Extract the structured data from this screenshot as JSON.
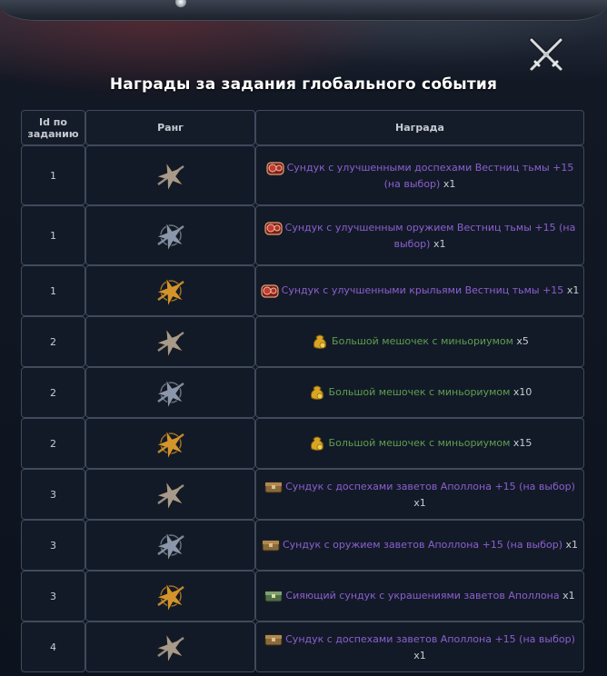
{
  "title": "Награды за задания глобального события",
  "columns": {
    "id": "Id по заданию",
    "rank": "Ранг",
    "reward": "Награда"
  },
  "rows": [
    {
      "id": "1",
      "rank_icon": "rank-bronze-star-icon",
      "item_icon": "red-chest-icon",
      "item": "Сундук с улучшенными доспехами Вестниц тьмы +15 (на выбор)",
      "qty": "x1",
      "color": "purple"
    },
    {
      "id": "1",
      "rank_icon": "rank-silver-star-icon",
      "item_icon": "red-chest-icon",
      "item": "Сундук с улучшенным оружием Вестниц тьмы +15 (на выбор)",
      "qty": "x1",
      "color": "purple"
    },
    {
      "id": "1",
      "rank_icon": "rank-gold-star-icon",
      "item_icon": "red-chest-icon",
      "item": "Сундук с улучшенными крыльями Вестниц тьмы +15",
      "qty": "x1",
      "color": "purple"
    },
    {
      "id": "2",
      "rank_icon": "rank-bronze-star-icon",
      "item_icon": "coin-pouch-icon",
      "item": "Большой мешочек с миньориумом",
      "qty": "x5",
      "color": "green"
    },
    {
      "id": "2",
      "rank_icon": "rank-silver-star-icon",
      "item_icon": "coin-pouch-icon",
      "item": "Большой мешочек с миньориумом",
      "qty": "x10",
      "color": "green"
    },
    {
      "id": "2",
      "rank_icon": "rank-gold-star-icon",
      "item_icon": "coin-pouch-icon",
      "item": "Большой мешочек с миньориумом",
      "qty": "x15",
      "color": "green"
    },
    {
      "id": "3",
      "rank_icon": "rank-bronze-star-icon",
      "item_icon": "wooden-chest-icon",
      "item": "Сундук с доспехами заветов Аполлона +15 (на выбор)",
      "qty": "x1",
      "color": "purple"
    },
    {
      "id": "3",
      "rank_icon": "rank-silver-star-icon",
      "item_icon": "wooden-chest-icon",
      "item": "Сундук с оружием заветов Аполлона +15 (на выбор)",
      "qty": "x1",
      "color": "purple"
    },
    {
      "id": "3",
      "rank_icon": "rank-gold-star-icon",
      "item_icon": "green-chest-icon",
      "item": "Сияющий сундук с украшениями заветов Аполлона",
      "qty": "x1",
      "color": "purple"
    },
    {
      "id": "4",
      "rank_icon": "rank-bronze-star-icon",
      "item_icon": "wooden-chest-icon",
      "item": "Сундук с доспехами заветов Аполлона +15 (на выбор)",
      "qty": "x1",
      "color": "purple"
    }
  ],
  "colors": {
    "purple_link": "#8c5fd0",
    "green_link": "#5f9e4f",
    "bronze": "#a89a8a",
    "silver": "#8a97ab",
    "gold": "#d4942c"
  }
}
